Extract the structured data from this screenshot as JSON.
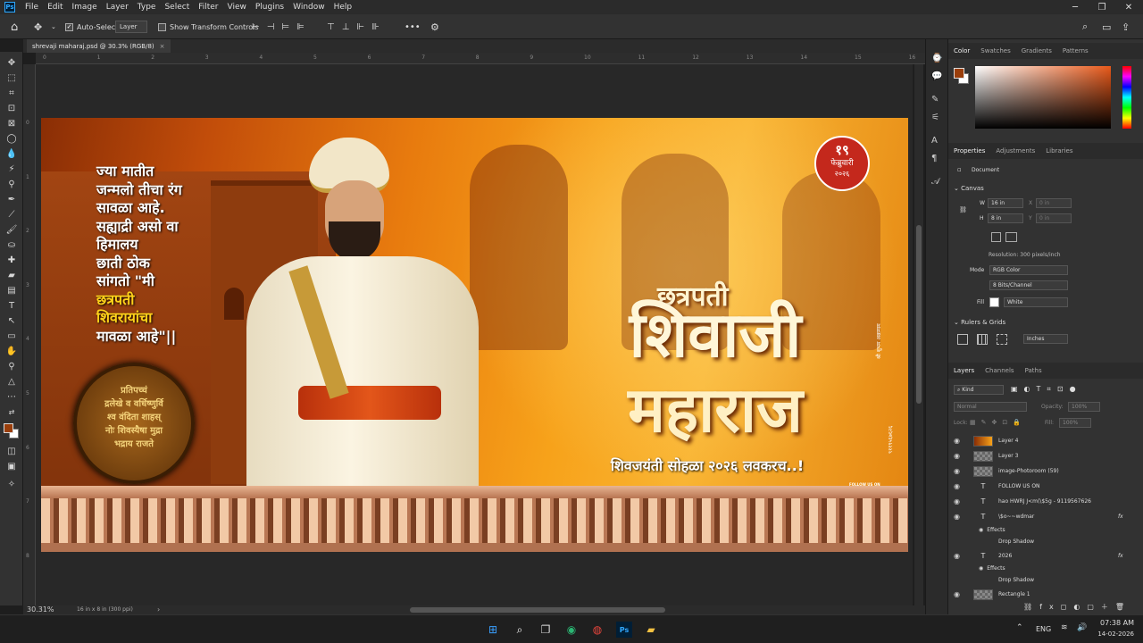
{
  "app": {
    "logo": "Ps",
    "menu": [
      "File",
      "Edit",
      "Image",
      "Layer",
      "Type",
      "Select",
      "Filter",
      "View",
      "Plugins",
      "Help",
      "Window"
    ],
    "menu_order": [
      "File",
      "Edit",
      "Image",
      "Layer",
      "Type",
      "Select",
      "Filter",
      "View",
      "Window",
      "Plugins",
      "Help"
    ]
  },
  "options_bar": {
    "auto_select_label": "Auto-Select:",
    "auto_select_target": "Layer",
    "show_transform_label": "Show Transform Controls",
    "more": "•••"
  },
  "document": {
    "tab_title": "shrevaji maharaj.psd @ 30.3% (RGB/8)",
    "zoom": "30.31%",
    "doc_info": "16 in x 8 in (300 ppi)"
  },
  "ruler_top": [
    "0",
    "1",
    "2",
    "3",
    "4",
    "5",
    "6",
    "7",
    "8",
    "9",
    "10",
    "11",
    "12",
    "13",
    "14",
    "15",
    "16"
  ],
  "ruler_left": [
    "0",
    "1",
    "2",
    "3",
    "4",
    "5",
    "6",
    "7",
    "8"
  ],
  "artwork": {
    "poem_lines": [
      "ज्या मातीत",
      "जन्मलो तीचा रंग",
      "सावळा आहे.",
      "सह्याद्री असो वा",
      "हिमालय",
      "छाती ठोक",
      "सांगतो \"मी"
    ],
    "poem_highlight": [
      "छत्रपती",
      "शिवरायांचा"
    ],
    "poem_end": "मावळा आहे\"||",
    "seal_lines": [
      "प्रतिपच्चं",
      "द्रलेखे व वर्धिष्णुर्वि",
      "श्व वंदिता शाहस्",
      "नोः शिवस्यैषा मुद्रा",
      "भद्राय राजते"
    ],
    "date_badge": [
      "१९",
      "फेब्रुवारी",
      "२०२६"
    ],
    "title_small": "छत्रपती",
    "title_line1": "शिवाजी",
    "title_line2": "महाराज",
    "subtitle": "शिवजयंती सोहळा २०२६ लवकरच..!",
    "vertical_text": "श्री शुभम अक्रम्यम",
    "vertical_number": "९११९५६७६२६",
    "follow": "FOLLOW US ON"
  },
  "panels": {
    "color_tabs": [
      "Color",
      "Swatches",
      "Gradients",
      "Patterns"
    ],
    "foreground_color": "#9a3e0b",
    "background_color": "#ffffff",
    "props_tabs": [
      "Properties",
      "Adjustments",
      "Libraries"
    ],
    "props_doc": "Document",
    "canvas_label": "Canvas",
    "width_label": "W",
    "width_value": "16 in",
    "height_label": "H",
    "height_value": "8 in",
    "x_label": "X",
    "x_value": "0 in",
    "y_label": "Y",
    "y_value": "0 in",
    "resolution": "Resolution: 300 pixels/inch",
    "mode_label": "Mode",
    "mode_value": "RGB Color",
    "bits_value": "8 Bits/Channel",
    "fill_label": "Fill",
    "fill_value": "White",
    "rulers_label": "Rulers & Grids",
    "units_value": "Inches",
    "layers_tabs": [
      "Layers",
      "Channels",
      "Paths"
    ],
    "kind": "Kind",
    "blend": "Normal",
    "opacity_label": "Opacity:",
    "opacity_value": "100%",
    "lock_label": "Lock:",
    "fill_pct_label": "Fill:",
    "fill_pct_value": "100%",
    "layers": [
      {
        "name": "Layer 4",
        "type": "image"
      },
      {
        "name": "Layer 3",
        "type": "image"
      },
      {
        "name": "image-Photoroom (59)",
        "type": "image"
      },
      {
        "name": "FOLLOW US ON",
        "type": "text"
      },
      {
        "name": "hao HWRJ J<m(\\$5g - 9119567626",
        "type": "text"
      },
      {
        "name": "\\$o~~wdmar",
        "type": "text",
        "fx": "fx"
      },
      {
        "name": "Effects",
        "type": "effects"
      },
      {
        "name": "Drop Shadow",
        "type": "effect"
      },
      {
        "name": "2026",
        "type": "text",
        "fx": "fx"
      },
      {
        "name": "Effects",
        "type": "effects"
      },
      {
        "name": "Drop Shadow",
        "type": "effect"
      },
      {
        "name": "Rectangle 1",
        "type": "shape"
      }
    ]
  },
  "taskbar": {
    "lang": "ENG",
    "time": "07:38 AM",
    "date": "14-02-2026"
  }
}
